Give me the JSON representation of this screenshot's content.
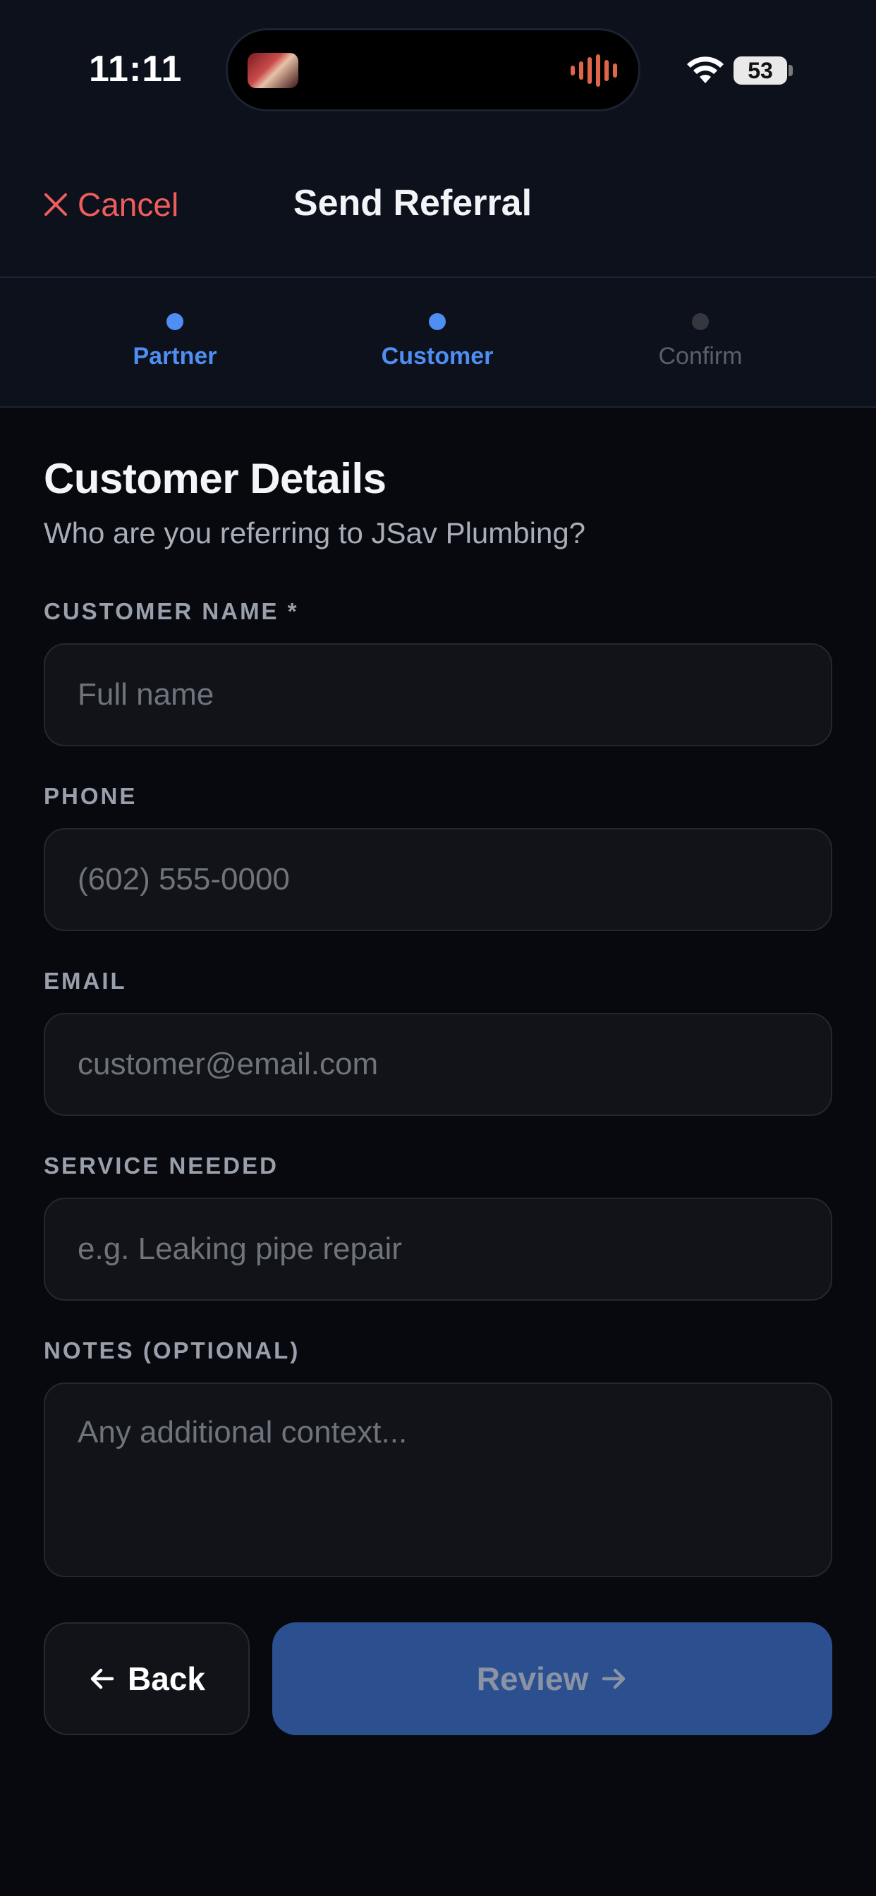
{
  "status_bar": {
    "time": "11:11",
    "battery": "53"
  },
  "header": {
    "cancel_label": "Cancel",
    "title": "Send Referral"
  },
  "steps": [
    {
      "label": "Partner",
      "state": "done",
      "color": "#4f8ef2"
    },
    {
      "label": "Customer",
      "state": "active",
      "color": "#4f8ef2"
    },
    {
      "label": "Confirm",
      "state": "upcoming",
      "color": "#5a5f6a"
    }
  ],
  "form": {
    "title": "Customer Details",
    "subtitle": "Who are you referring to JSav Plumbing?",
    "fields": {
      "name": {
        "label": "CUSTOMER NAME *",
        "placeholder": "Full name",
        "value": ""
      },
      "phone": {
        "label": "PHONE",
        "placeholder": "(602) 555-0000",
        "value": ""
      },
      "email": {
        "label": "EMAIL",
        "placeholder": "customer@email.com",
        "value": ""
      },
      "service": {
        "label": "SERVICE NEEDED",
        "placeholder": "e.g. Leaking pipe repair",
        "value": ""
      },
      "notes": {
        "label": "NOTES (OPTIONAL)",
        "placeholder": "Any additional context...",
        "value": ""
      }
    }
  },
  "actions": {
    "back_label": "Back",
    "review_label": "Review"
  },
  "colors": {
    "accent": "#4f8ef2",
    "danger": "#ef5d5d",
    "primary_button": "#2c4f90"
  }
}
